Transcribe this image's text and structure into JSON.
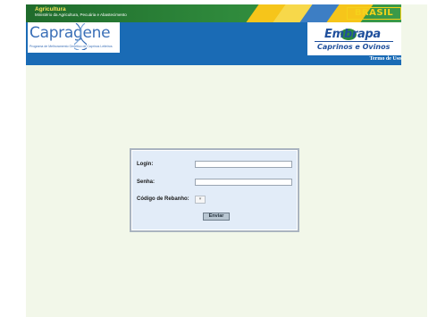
{
  "header": {
    "ministry_title": "Agricultura",
    "ministry_subtitle": "Ministério da Agricultura, Pecuária e Abastecimento",
    "country_logo_text": "BRASIL",
    "app_logo_text": "Capragene",
    "app_logo_tagline": "Programa de Melhoramento Genético de Caprinos Leiteiros",
    "org_logo_text": "Embrapa",
    "org_unit": "Caprinos e Ovinos",
    "terms_link": "Termo de Uso"
  },
  "login_form": {
    "login_label": "Login:",
    "login_value": "",
    "password_label": "Senha:",
    "password_value": "",
    "herd_label": "Código de Rebanho:",
    "herd_selected": "",
    "submit_label": "Enviar"
  },
  "colors": {
    "page_background": "#f2f7e9",
    "header_blue": "#1a6bb5",
    "gov_green": "#2c7a3a",
    "panel_background": "#e2ecf8"
  }
}
